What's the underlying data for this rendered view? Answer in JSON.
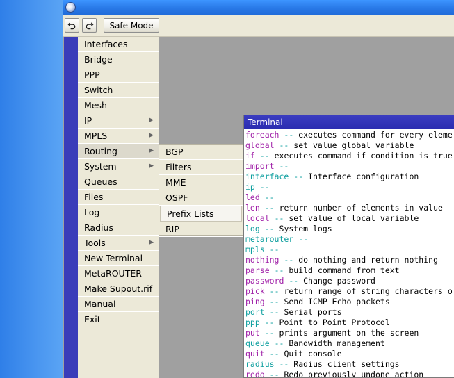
{
  "toolbar": {
    "undo_icon": "undo-icon",
    "redo_icon": "redo-icon",
    "safe_mode_label": "Safe Mode"
  },
  "menu": {
    "items": [
      {
        "label": "Interfaces",
        "has_submenu": false
      },
      {
        "label": "Bridge",
        "has_submenu": false
      },
      {
        "label": "PPP",
        "has_submenu": false
      },
      {
        "label": "Switch",
        "has_submenu": false
      },
      {
        "label": "Mesh",
        "has_submenu": false
      },
      {
        "label": "IP",
        "has_submenu": true
      },
      {
        "label": "MPLS",
        "has_submenu": true
      },
      {
        "label": "Routing",
        "has_submenu": true
      },
      {
        "label": "System",
        "has_submenu": true
      },
      {
        "label": "Queues",
        "has_submenu": false
      },
      {
        "label": "Files",
        "has_submenu": false
      },
      {
        "label": "Log",
        "has_submenu": false
      },
      {
        "label": "Radius",
        "has_submenu": false
      },
      {
        "label": "Tools",
        "has_submenu": true
      },
      {
        "label": "New Terminal",
        "has_submenu": false
      },
      {
        "label": "MetaROUTER",
        "has_submenu": false
      },
      {
        "label": "Make Supout.rif",
        "has_submenu": false
      },
      {
        "label": "Manual",
        "has_submenu": false
      },
      {
        "label": "Exit",
        "has_submenu": false
      }
    ],
    "active_item": "Routing"
  },
  "routing_submenu": {
    "items": [
      "BGP",
      "Filters",
      "MME",
      "OSPF",
      "Prefix Lists",
      "RIP"
    ],
    "selected_item": "Prefix Lists"
  },
  "terminal": {
    "title": "Terminal",
    "lines": [
      {
        "cmd": "foreach",
        "desc": "executes command for every eleme",
        "color": "purple"
      },
      {
        "cmd": "global",
        "desc": "set value global variable",
        "color": "purple"
      },
      {
        "cmd": "if",
        "desc": "executes command if condition is true",
        "color": "purple"
      },
      {
        "cmd": "import",
        "desc": "",
        "color": "purple"
      },
      {
        "cmd": "interface",
        "desc": "Interface configuration",
        "color": "teal"
      },
      {
        "cmd": "ip",
        "desc": "",
        "color": "teal"
      },
      {
        "cmd": "led",
        "desc": "",
        "color": "purple"
      },
      {
        "cmd": "len",
        "desc": "return number of elements in value",
        "color": "purple"
      },
      {
        "cmd": "local",
        "desc": "set value of local variable",
        "color": "purple"
      },
      {
        "cmd": "log",
        "desc": "System logs",
        "color": "teal"
      },
      {
        "cmd": "metarouter",
        "desc": "",
        "color": "teal"
      },
      {
        "cmd": "mpls",
        "desc": "",
        "color": "teal"
      },
      {
        "cmd": "nothing",
        "desc": "do nothing and return nothing",
        "color": "purple"
      },
      {
        "cmd": "parse",
        "desc": "build command from text",
        "color": "purple"
      },
      {
        "cmd": "password",
        "desc": "Change password",
        "color": "purple"
      },
      {
        "cmd": "pick",
        "desc": "return range of string characters o",
        "color": "purple"
      },
      {
        "cmd": "ping",
        "desc": "Send ICMP Echo packets",
        "color": "purple"
      },
      {
        "cmd": "port",
        "desc": "Serial ports",
        "color": "teal"
      },
      {
        "cmd": "ppp",
        "desc": "Point to Point Protocol",
        "color": "teal"
      },
      {
        "cmd": "put",
        "desc": "prints argument on the screen",
        "color": "purple"
      },
      {
        "cmd": "queue",
        "desc": "Bandwidth management",
        "color": "teal"
      },
      {
        "cmd": "quit",
        "desc": "Quit console",
        "color": "purple"
      },
      {
        "cmd": "radius",
        "desc": "Radius client settings",
        "color": "teal"
      },
      {
        "cmd": "redo",
        "desc": "Redo previously undone action",
        "color": "purple"
      }
    ],
    "separator": "--"
  },
  "colors": {
    "accent_purple": "#a020a8",
    "accent_teal": "#10a0a0",
    "sidebar_strip": "#3a3cb9",
    "terminal_title": "#2a2cb0"
  }
}
